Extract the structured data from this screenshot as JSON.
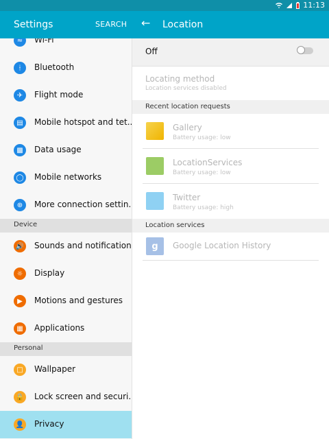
{
  "status": {
    "time": "11:13"
  },
  "appbar": {
    "left_title": "Settings",
    "search_label": "SEARCH",
    "right_title": "Location"
  },
  "left": {
    "items": [
      {
        "label": "Wi-Fi",
        "icon": "wifi-icon",
        "color": "#1e88e5"
      },
      {
        "label": "Bluetooth",
        "icon": "bluetooth-icon",
        "color": "#1e88e5"
      },
      {
        "label": "Flight mode",
        "icon": "airplane-icon",
        "color": "#1e88e5"
      },
      {
        "label": "Mobile hotspot and tet..",
        "icon": "hotspot-icon",
        "color": "#1e88e5"
      },
      {
        "label": "Data usage",
        "icon": "data-usage-icon",
        "color": "#1e88e5"
      },
      {
        "label": "Mobile networks",
        "icon": "mobile-networks-icon",
        "color": "#1e88e5"
      },
      {
        "label": "More connection settin..",
        "icon": "more-connection-icon",
        "color": "#1e88e5"
      }
    ],
    "device_header": "Device",
    "device_items": [
      {
        "label": "Sounds and notification..",
        "icon": "sound-icon",
        "color": "#ef6c00"
      },
      {
        "label": "Display",
        "icon": "display-icon",
        "color": "#ef6c00"
      },
      {
        "label": "Motions and gestures",
        "icon": "motions-icon",
        "color": "#ef6c00"
      },
      {
        "label": "Applications",
        "icon": "applications-icon",
        "color": "#ef6c00"
      }
    ],
    "personal_header": "Personal",
    "personal_items": [
      {
        "label": "Wallpaper",
        "icon": "wallpaper-icon",
        "color": "#f9a825"
      },
      {
        "label": "Lock screen and securi..",
        "icon": "lock-icon",
        "color": "#f9a825"
      },
      {
        "label": "Privacy",
        "icon": "privacy-icon",
        "color": "#f9a825"
      }
    ]
  },
  "right": {
    "toggle_label": "Off",
    "locating_method_title": "Locating method",
    "locating_method_sub": "Location services disabled",
    "recent_header": "Recent location requests",
    "requests": [
      {
        "title": "Gallery",
        "sub": "Battery usage: low",
        "icon": "gallery-icon"
      },
      {
        "title": "LocationServices",
        "sub": "Battery usage: low",
        "icon": "android-icon"
      },
      {
        "title": "Twitter",
        "sub": "Battery usage: high",
        "icon": "twitter-icon"
      }
    ],
    "services_header": "Location services",
    "services": [
      {
        "title": "Google Location History",
        "icon": "google-icon"
      }
    ]
  }
}
